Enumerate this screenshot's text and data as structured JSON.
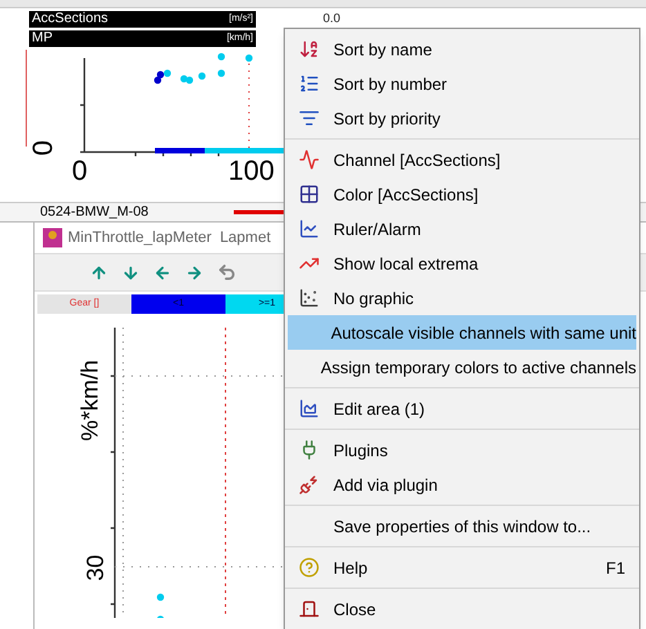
{
  "upper_window": {
    "channels": [
      {
        "name": "AccSections",
        "unit": "[m/s²]",
        "value": "0.0"
      },
      {
        "name": "MP",
        "unit": "[km/h]"
      }
    ],
    "chart": {
      "y_tick": "0",
      "x_ticks": [
        "0",
        "100"
      ]
    },
    "row_label": "0524-BMW_M-08"
  },
  "lower_window": {
    "title": "MinThrottle_lapMeter",
    "title_2": "Lapmet",
    "gear_bar": {
      "label": "Gear []",
      "segments": [
        {
          "label": "<1",
          "color": "#0000ee"
        },
        {
          "label": ">=1",
          "color": "#00d8f0"
        }
      ]
    },
    "chart": {
      "ylabel": "%*km/h",
      "y_tick": "30"
    }
  },
  "context_menu": {
    "groups": [
      [
        {
          "label": "Sort by name",
          "selected": false
        },
        {
          "label": "Sort by number",
          "selected": false
        },
        {
          "label": "Sort by priority",
          "selected": false
        }
      ],
      [
        {
          "label": "Channel  [AccSections]",
          "selected": false
        },
        {
          "label": "Color  [AccSections]",
          "selected": false
        },
        {
          "label": "Ruler/Alarm",
          "selected": false
        },
        {
          "label": "Show local extrema",
          "selected": false
        },
        {
          "label": "No graphic",
          "selected": false
        },
        {
          "label": "Autoscale visible channels with same unit",
          "selected": true
        },
        {
          "label": "Assign temporary colors to active channels",
          "selected": false
        }
      ],
      [
        {
          "label": "Edit area (1)",
          "selected": false
        }
      ],
      [
        {
          "label": "Plugins",
          "selected": false
        },
        {
          "label": "Add via plugin",
          "selected": false
        }
      ],
      [
        {
          "label": "Save properties of this window to...",
          "selected": false
        }
      ],
      [
        {
          "label": "Help",
          "shortcut": "F1",
          "selected": false
        }
      ],
      [
        {
          "label": "Close",
          "selected": false
        }
      ]
    ]
  }
}
